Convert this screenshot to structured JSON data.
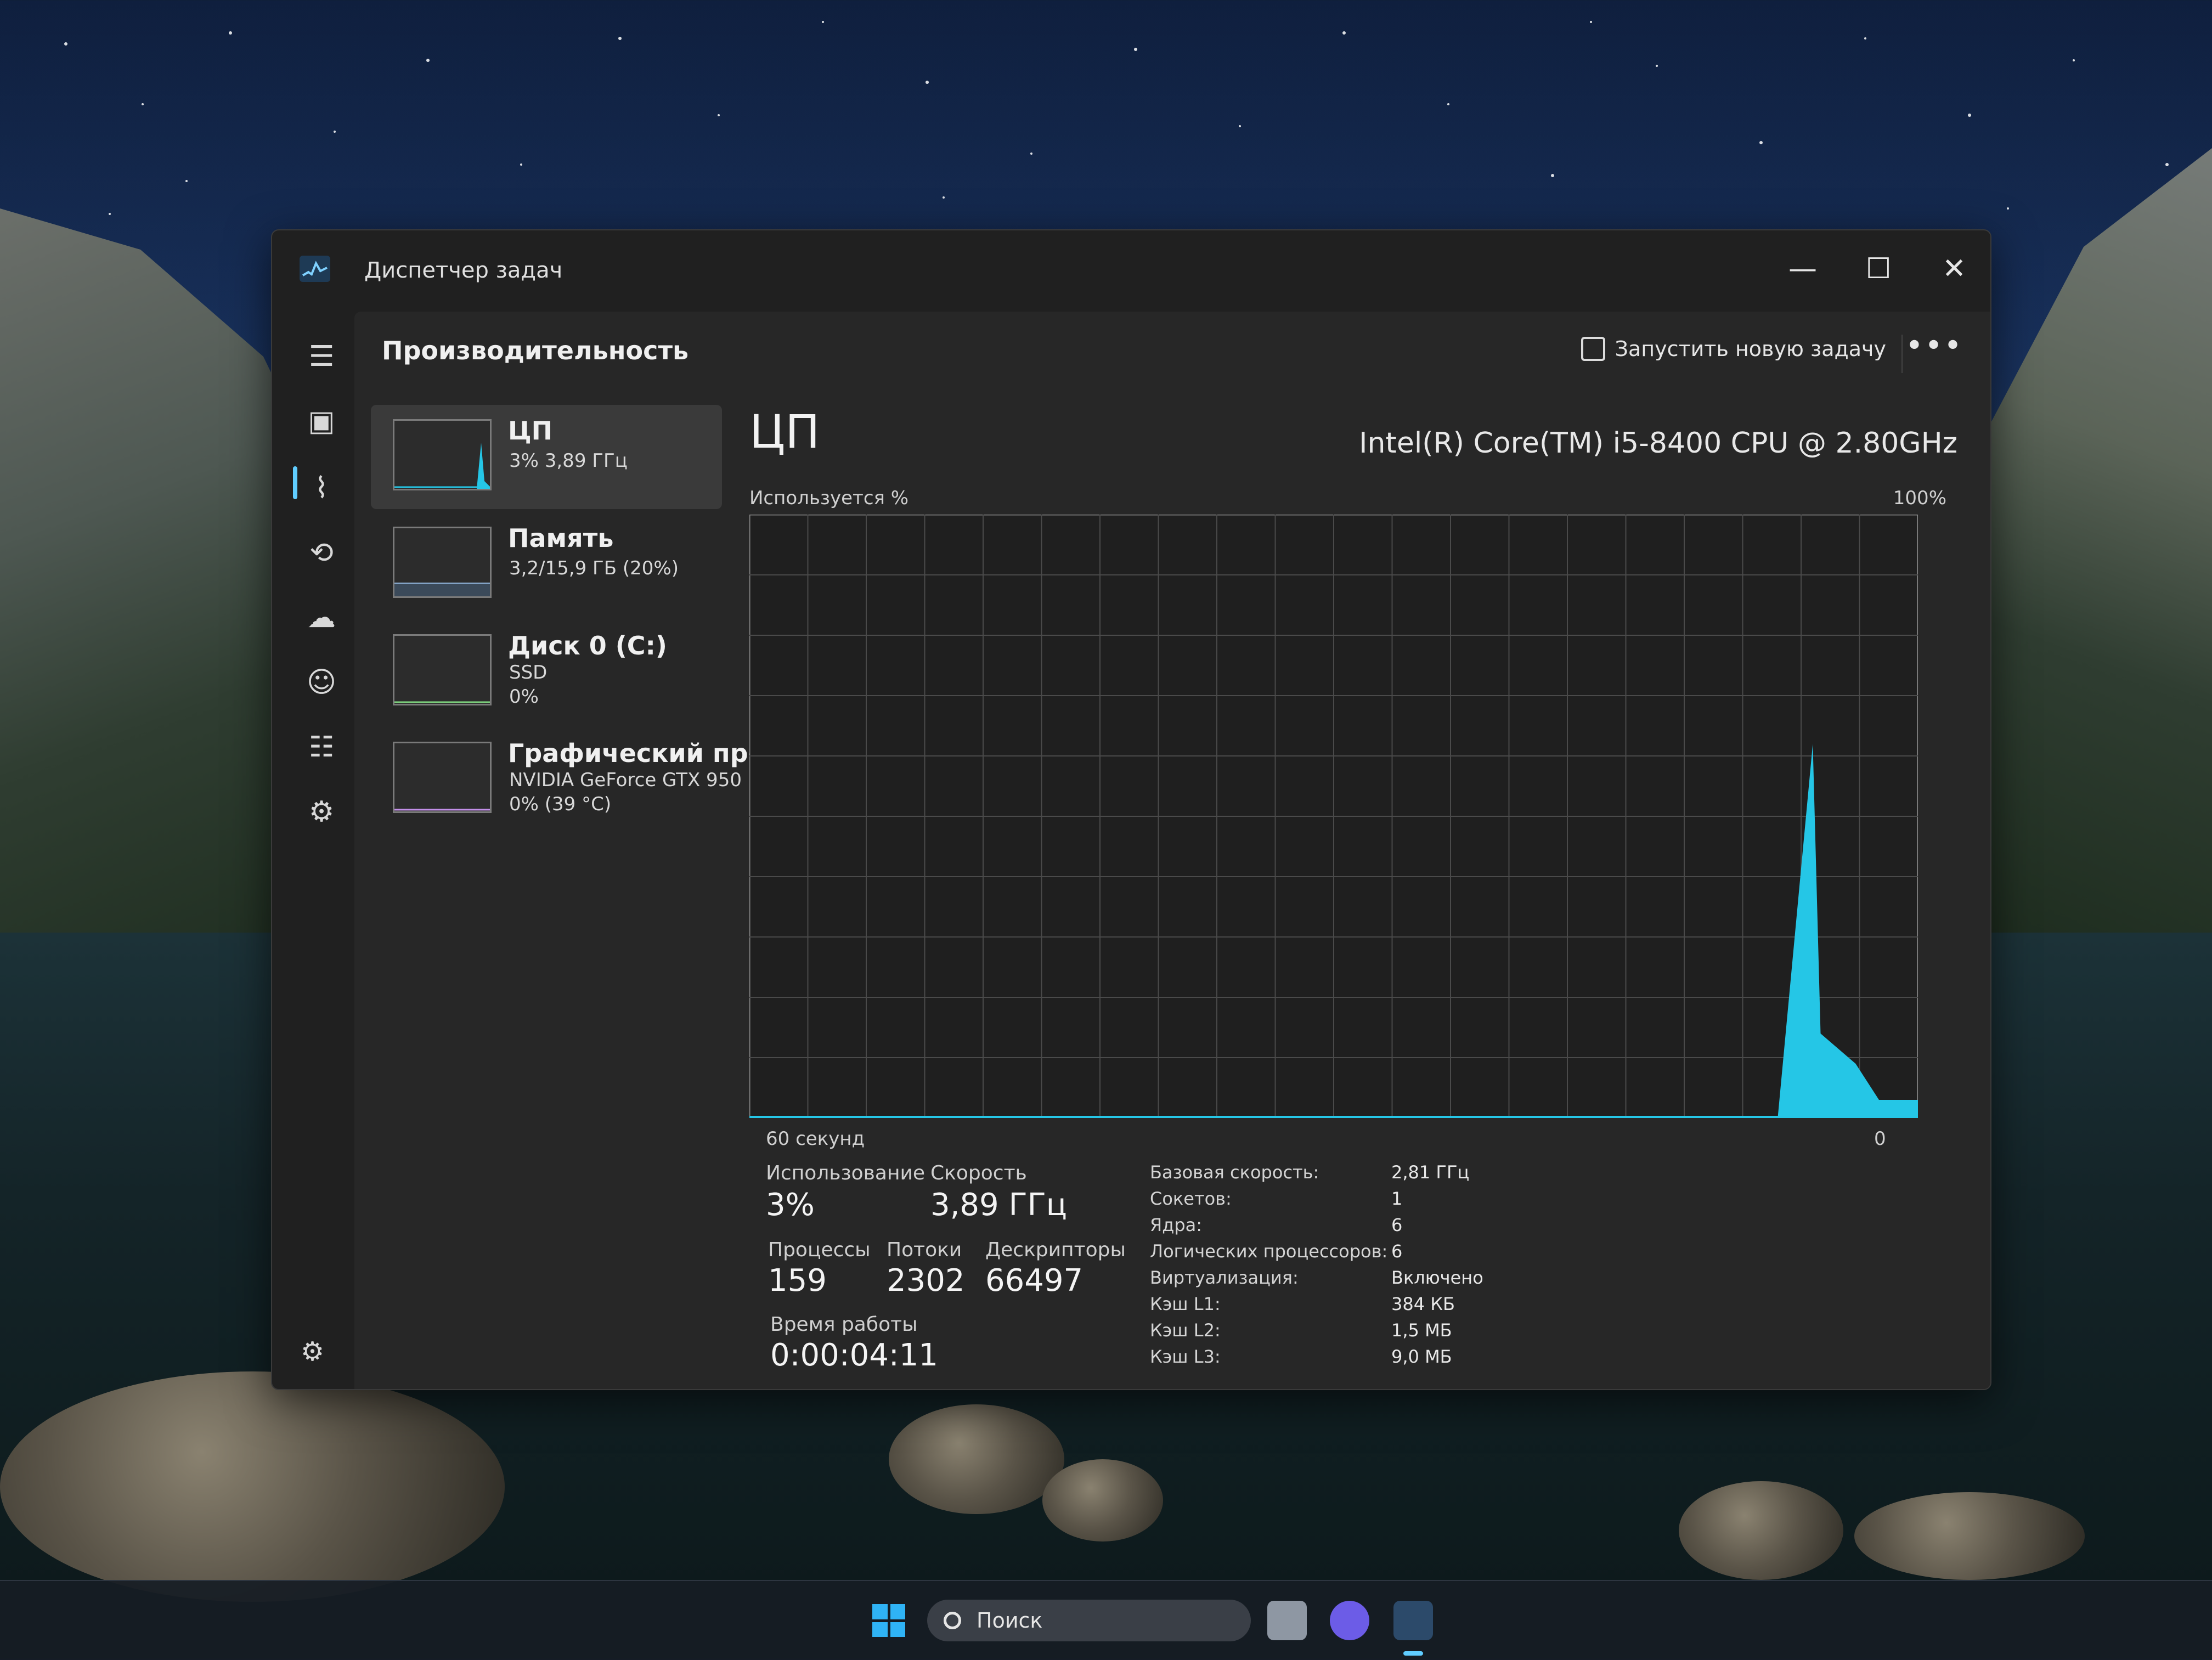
{
  "window": {
    "title": "Диспетчер задач",
    "minimize_glyph": "—",
    "maximize_glyph": "☐",
    "close_glyph": "✕"
  },
  "header": {
    "title": "Производительность",
    "run_task_label": "Запустить новую задачу",
    "more_glyph": "•••"
  },
  "nav": {
    "icons": [
      "menu-icon",
      "processes-icon",
      "performance-icon",
      "app-history-icon",
      "startup-icon",
      "users-icon",
      "details-icon",
      "services-icon",
      "settings-icon"
    ],
    "glyphs": [
      "☰",
      "▣",
      "⌇",
      "⟲",
      "☁",
      "☺",
      "☷",
      "⚙",
      "⚙"
    ]
  },
  "resources": [
    {
      "name": "ЦП",
      "line1": "3% 3,89 ГГц",
      "line2": "",
      "line3": ""
    },
    {
      "name": "Память",
      "line1": "3,2/15,9 ГБ (20%)",
      "line2": "",
      "line3": ""
    },
    {
      "name": "Диск 0 (C:)",
      "line1": "SSD",
      "line2": "0%",
      "line3": ""
    },
    {
      "name": "Графический про",
      "line1": "NVIDIA GeForce GTX 950",
      "line2": "0% (39 °C)",
      "line3": ""
    }
  ],
  "main": {
    "title": "ЦП",
    "model": "Intel(R) Core(TM) i5-8400 CPU @ 2.80GHz",
    "y_label": "Используется %",
    "y_max_label": "100%",
    "x_left_label": "60 секунд",
    "x_right_label": "0"
  },
  "chart_data": {
    "type": "area",
    "title": "",
    "xlabel": "60 секунд",
    "ylabel": "Используется %",
    "ylim": [
      0,
      100
    ],
    "xlim": [
      60,
      0
    ],
    "grid": true,
    "series": [
      {
        "values": [
          {
            "x": 7.2,
            "y": 0
          },
          {
            "x": 5.4,
            "y": 62
          },
          {
            "x": 5.0,
            "y": 14
          },
          {
            "x": 3.2,
            "y": 9
          },
          {
            "x": 2.0,
            "y": 3
          },
          {
            "x": 0.0,
            "y": 3
          }
        ]
      }
    ],
    "fill_color": "#25c6e6"
  },
  "stats": {
    "usage_label": "Использование",
    "usage_value": "3%",
    "speed_label": "Скорость",
    "speed_value": "3,89 ГГц",
    "processes_label": "Процессы",
    "processes_value": "159",
    "threads_label": "Потоки",
    "threads_value": "2302",
    "handles_label": "Дескрипторы",
    "handles_value": "66497",
    "uptime_label": "Время работы",
    "uptime_value": "0:00:04:11"
  },
  "details": [
    {
      "label": "Базовая скорость:",
      "value": "2,81 ГГц"
    },
    {
      "label": "Сокетов:",
      "value": "1"
    },
    {
      "label": "Ядра:",
      "value": "6"
    },
    {
      "label": "Логических процессоров:",
      "value": "6"
    },
    {
      "label": "Виртуализация:",
      "value": "Включено"
    },
    {
      "label": "Кэш L1:",
      "value": "384 КБ"
    },
    {
      "label": "Кэш L2:",
      "value": "1,5 МБ"
    },
    {
      "label": "Кэш L3:",
      "value": "9,0 МБ"
    }
  ],
  "taskbar": {
    "search_label": "Поиск"
  },
  "colors": {
    "accent": "#60cdff",
    "graph_fill": "#25c6e6",
    "graph_border": "#8a8a8a",
    "grid": "#4a4a4a"
  }
}
